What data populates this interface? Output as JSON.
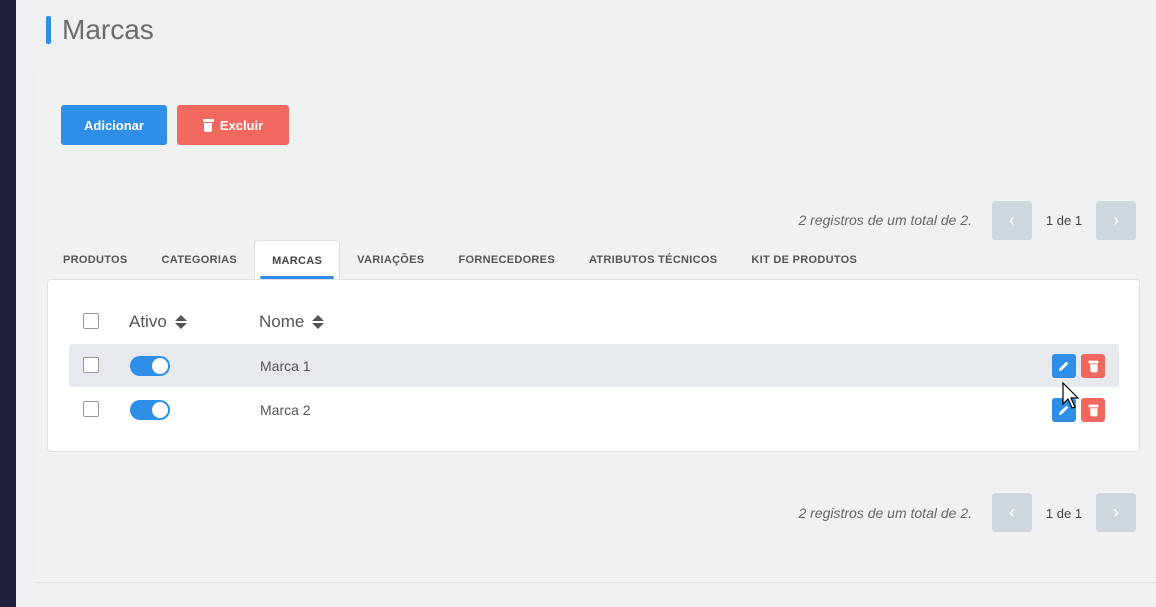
{
  "page": {
    "title": "Marcas"
  },
  "toolbar": {
    "add_label": "Adicionar",
    "delete_label": "Excluir"
  },
  "pagination": {
    "records_text": "2 registros de um total de 2.",
    "page_text": "1 de 1",
    "prev_glyph": "‹",
    "next_glyph": "›"
  },
  "tabs": [
    {
      "label": "PRODUTOS",
      "active": false
    },
    {
      "label": "CATEGORIAS",
      "active": false
    },
    {
      "label": "MARCAS",
      "active": true
    },
    {
      "label": "VARIAÇÕES",
      "active": false
    },
    {
      "label": "FORNECEDORES",
      "active": false
    },
    {
      "label": "ATRIBUTOS TÉCNICOS",
      "active": false
    },
    {
      "label": "KIT DE PRODUTOS",
      "active": false
    }
  ],
  "table": {
    "headers": {
      "active": "Ativo",
      "name": "Nome"
    },
    "rows": [
      {
        "name": "Marca 1",
        "active": true
      },
      {
        "name": "Marca 2",
        "active": true
      }
    ]
  },
  "colors": {
    "primary": "#2f8fe8",
    "danger": "#f0685e",
    "sidebar": "#1f1f3d"
  },
  "icons": {
    "edit": "pencil-icon",
    "delete": "trash-icon",
    "sort": "sort-icon",
    "prev": "chevron-left-icon",
    "next": "chevron-right-icon"
  }
}
